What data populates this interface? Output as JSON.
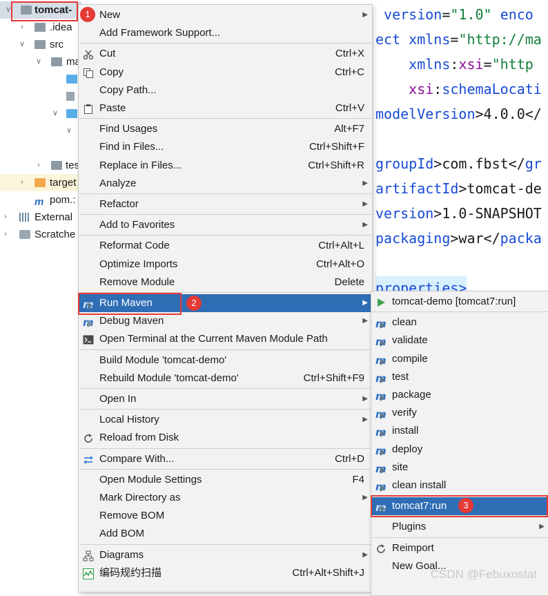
{
  "tree": {
    "root": "tomcat-",
    "items": [
      ".idea",
      "src",
      "ma",
      "tes",
      "target",
      "pom.:",
      "External",
      "Scratche"
    ]
  },
  "editor": {
    "lines": [
      [
        [
          "txt",
          " "
        ],
        [
          "kw",
          "version"
        ],
        [
          "txt",
          "="
        ],
        [
          "str",
          "\"1.0\""
        ],
        [
          "txt",
          " "
        ],
        [
          "kw",
          "enco"
        ]
      ],
      [
        [
          "kw",
          "ect"
        ],
        [
          "txt",
          " "
        ],
        [
          "kw",
          "xmlns"
        ],
        [
          "txt",
          "="
        ],
        [
          "str",
          "\"http://ma"
        ]
      ],
      [
        [
          "txt",
          "    "
        ],
        [
          "kw",
          "xmlns"
        ],
        [
          "txt",
          ":"
        ],
        [
          "at",
          "xsi"
        ],
        [
          "txt",
          "="
        ],
        [
          "str",
          "\"http"
        ]
      ],
      [
        [
          "txt",
          "    "
        ],
        [
          "at",
          "xsi"
        ],
        [
          "txt",
          ":"
        ],
        [
          "kw",
          "schemaLocati"
        ]
      ],
      [
        [
          "kw",
          "modelVersion"
        ],
        [
          "txt",
          ">4.0.0</"
        ]
      ],
      [
        [
          "txt",
          ""
        ]
      ],
      [
        [
          "kw",
          "groupId"
        ],
        [
          "txt",
          ">com.fbst</"
        ],
        [
          "kw",
          "gr"
        ]
      ],
      [
        [
          "kw",
          "artifactId"
        ],
        [
          "txt",
          ">tomcat-de"
        ]
      ],
      [
        [
          "kw",
          "version"
        ],
        [
          "txt",
          ">1.0-SNAPSHOT"
        ]
      ],
      [
        [
          "kw",
          "packaging"
        ],
        [
          "txt",
          ">war</"
        ],
        [
          "kw",
          "packa"
        ]
      ],
      [
        [
          "txt",
          ""
        ]
      ],
      [
        [
          "kw",
          "properties>"
        ]
      ]
    ]
  },
  "context_menu": [
    {
      "label": "New",
      "arrow": true
    },
    {
      "label": "Add Framework Support..."
    },
    {
      "sep": true
    },
    {
      "label": "Cut",
      "shortcut": "Ctrl+X",
      "icon": "scissors-icon"
    },
    {
      "label": "Copy",
      "shortcut": "Ctrl+C",
      "icon": "copy-icon"
    },
    {
      "label": "Copy Path..."
    },
    {
      "label": "Paste",
      "shortcut": "Ctrl+V",
      "icon": "paste-icon"
    },
    {
      "sep": true
    },
    {
      "label": "Find Usages",
      "shortcut": "Alt+F7"
    },
    {
      "label": "Find in Files...",
      "shortcut": "Ctrl+Shift+F"
    },
    {
      "label": "Replace in Files...",
      "shortcut": "Ctrl+Shift+R"
    },
    {
      "label": "Analyze",
      "arrow": true
    },
    {
      "sep": true
    },
    {
      "label": "Refactor",
      "arrow": true
    },
    {
      "sep": true
    },
    {
      "label": "Add to Favorites",
      "arrow": true
    },
    {
      "sep": true
    },
    {
      "label": "Reformat Code",
      "shortcut": "Ctrl+Alt+L"
    },
    {
      "label": "Optimize Imports",
      "shortcut": "Ctrl+Alt+O"
    },
    {
      "label": "Remove Module",
      "shortcut": "Delete"
    },
    {
      "sep": true
    },
    {
      "label": "Run Maven",
      "arrow": true,
      "icon": "maven-run-icon",
      "highlight": true
    },
    {
      "label": "Debug Maven",
      "arrow": true,
      "icon": "maven-debug-icon"
    },
    {
      "label": "Open Terminal at the Current Maven Module Path",
      "icon": "terminal-icon"
    },
    {
      "sep": true
    },
    {
      "label": "Build Module 'tomcat-demo'"
    },
    {
      "label": "Rebuild Module 'tomcat-demo'",
      "shortcut": "Ctrl+Shift+F9"
    },
    {
      "sep": true
    },
    {
      "label": "Open In",
      "arrow": true
    },
    {
      "sep": true
    },
    {
      "label": "Local History",
      "arrow": true
    },
    {
      "label": "Reload from Disk",
      "icon": "reload-icon"
    },
    {
      "sep": true
    },
    {
      "label": "Compare With...",
      "shortcut": "Ctrl+D",
      "icon": "compare-icon"
    },
    {
      "sep": true
    },
    {
      "label": "Open Module Settings",
      "shortcut": "F4"
    },
    {
      "label": "Mark Directory as",
      "arrow": true
    },
    {
      "label": "Remove BOM"
    },
    {
      "label": "Add BOM"
    },
    {
      "sep": true
    },
    {
      "label": "Diagrams",
      "arrow": true,
      "icon": "diagram-icon"
    },
    {
      "label": "编码规约扫描",
      "shortcut": "Ctrl+Alt+Shift+J",
      "icon": "scan-icon"
    }
  ],
  "submenu": [
    {
      "label": "tomcat-demo [tomcat7:run]",
      "icon": "run-green-icon"
    },
    {
      "sep": true
    },
    {
      "label": "clean",
      "icon": "maven-goal-icon"
    },
    {
      "label": "validate",
      "icon": "maven-goal-icon"
    },
    {
      "label": "compile",
      "icon": "maven-goal-icon"
    },
    {
      "label": "test",
      "icon": "maven-goal-icon"
    },
    {
      "label": "package",
      "icon": "maven-goal-icon"
    },
    {
      "label": "verify",
      "icon": "maven-goal-icon"
    },
    {
      "label": "install",
      "icon": "maven-goal-icon"
    },
    {
      "label": "deploy",
      "icon": "maven-goal-icon"
    },
    {
      "label": "site",
      "icon": "maven-goal-icon"
    },
    {
      "label": "clean install",
      "icon": "maven-goal-icon"
    },
    {
      "sep": true
    },
    {
      "label": "tomcat7:run",
      "icon": "maven-goal-icon",
      "highlight": true
    },
    {
      "sep": true
    },
    {
      "label": "Plugins",
      "arrow": true
    },
    {
      "sep": true
    },
    {
      "label": "Reimport",
      "icon": "reload-icon"
    },
    {
      "label": "New Goal..."
    }
  ],
  "callouts": [
    "1",
    "2",
    "3"
  ],
  "watermark": "CSDN @Febuxostat",
  "colors": {
    "highlight": "#2f6db5",
    "callout": "#e53935"
  }
}
